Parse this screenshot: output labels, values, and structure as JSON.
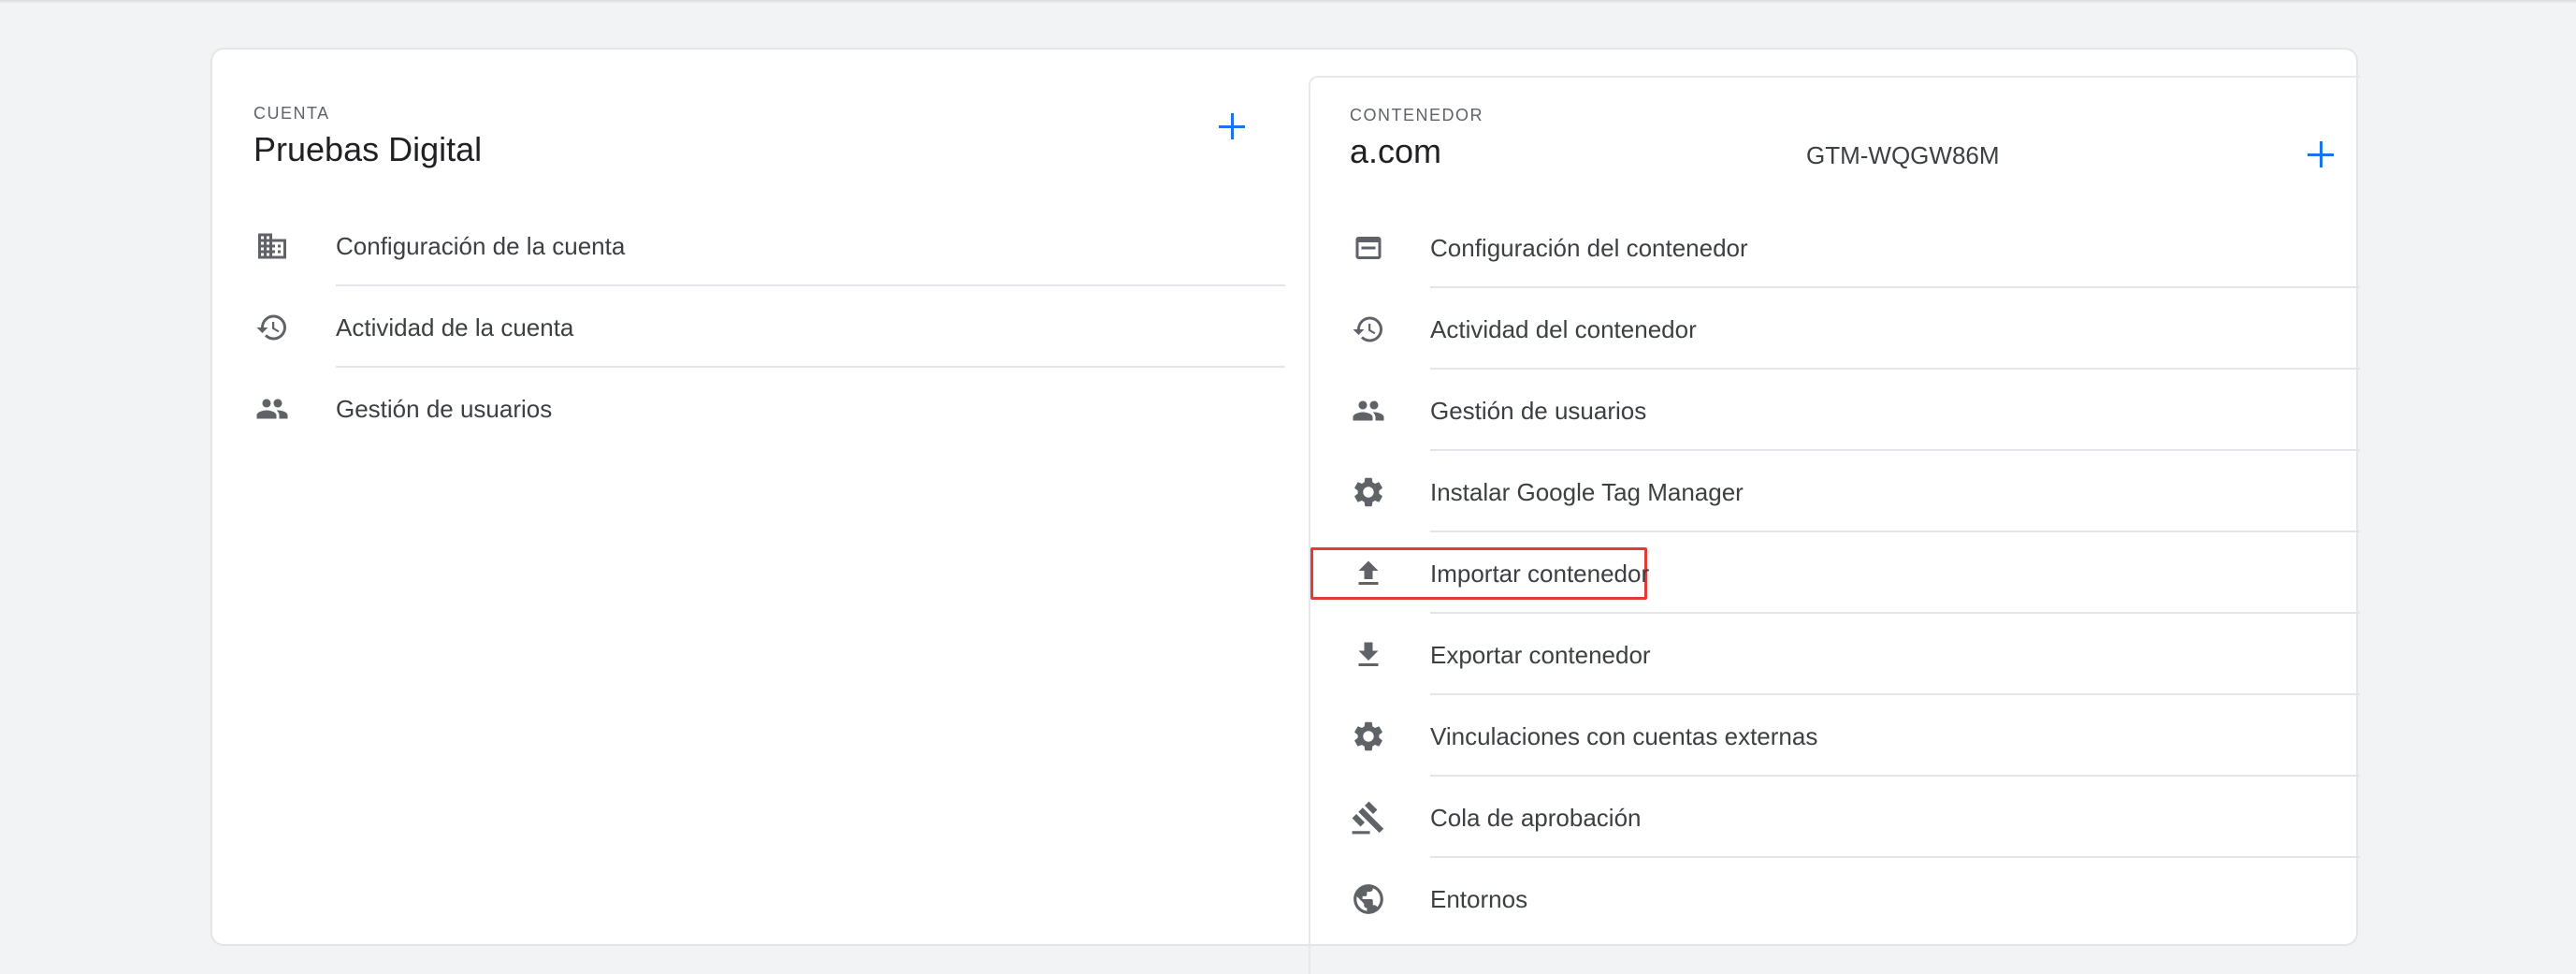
{
  "account": {
    "section_label": "CUENTA",
    "name": "Pruebas Digital",
    "items": [
      {
        "label": "Configuración de la cuenta",
        "icon": "building-icon"
      },
      {
        "label": "Actividad de la cuenta",
        "icon": "history-icon"
      },
      {
        "label": "Gestión de usuarios",
        "icon": "people-icon"
      }
    ]
  },
  "container": {
    "section_label": "CONTENEDOR",
    "name": "a.com",
    "id": "GTM-WQGW86M",
    "highlighted_item": "Importar contenedor",
    "items": [
      {
        "label": "Configuración del contenedor",
        "icon": "web-asset-icon"
      },
      {
        "label": "Actividad del contenedor",
        "icon": "history-icon"
      },
      {
        "label": "Gestión de usuarios",
        "icon": "people-icon"
      },
      {
        "label": "Instalar Google Tag Manager",
        "icon": "gear-icon"
      },
      {
        "label": "Importar contenedor",
        "icon": "upload-icon"
      },
      {
        "label": "Exportar contenedor",
        "icon": "download-icon"
      },
      {
        "label": "Vinculaciones con cuentas externas",
        "icon": "gear-icon"
      },
      {
        "label": "Cola de aprobación",
        "icon": "gavel-icon"
      },
      {
        "label": "Entornos",
        "icon": "globe-icon"
      }
    ]
  },
  "colors": {
    "accent": "#1a73e8",
    "highlight": "#e53935",
    "icon": "#5f6368"
  }
}
